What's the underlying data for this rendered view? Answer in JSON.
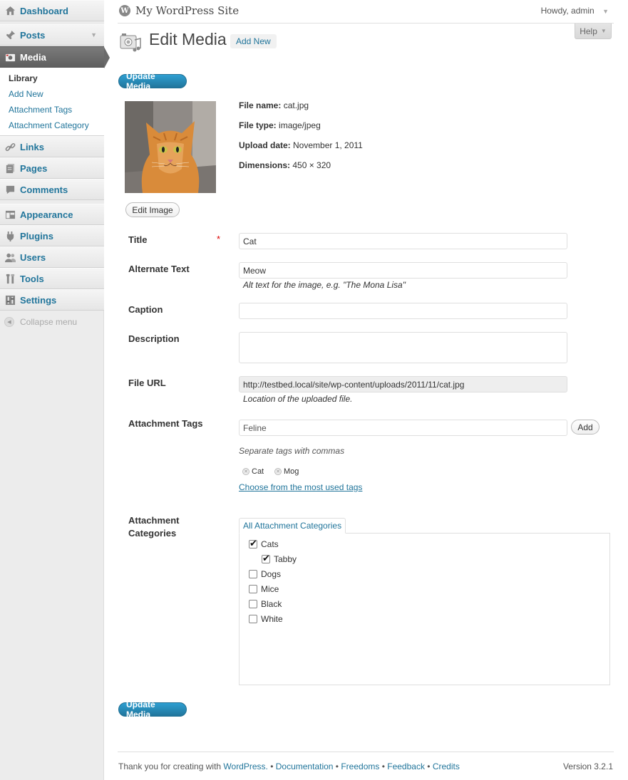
{
  "site": {
    "title": "My WordPress Site",
    "howdy": "Howdy, admin"
  },
  "help": {
    "label": "Help"
  },
  "sidebar": {
    "dashboard": "Dashboard",
    "posts": "Posts",
    "media": "Media",
    "media_submenu": [
      "Library",
      "Add New",
      "Attachment Tags",
      "Attachment Category"
    ],
    "links": "Links",
    "pages": "Pages",
    "comments": "Comments",
    "appearance": "Appearance",
    "plugins": "Plugins",
    "users": "Users",
    "tools": "Tools",
    "settings": "Settings",
    "collapse": "Collapse menu"
  },
  "page": {
    "title": "Edit Media",
    "add_new": "Add New",
    "update_button": "Update Media",
    "edit_image_button": "Edit Image"
  },
  "meta": {
    "file_name_label": "File name:",
    "file_name": "cat.jpg",
    "file_type_label": "File type:",
    "file_type": "image/jpeg",
    "upload_date_label": "Upload date:",
    "upload_date": "November 1, 2011",
    "dimensions_label": "Dimensions:",
    "dimensions": "450 × 320"
  },
  "fields": {
    "title_label": "Title",
    "required_mark": "*",
    "title_value": "Cat",
    "alt_label": "Alternate Text",
    "alt_value": "Meow",
    "alt_help": "Alt text for the image, e.g. \"The Mona Lisa\"",
    "caption_label": "Caption",
    "caption_value": "",
    "description_label": "Description",
    "description_value": "",
    "url_label": "File URL",
    "url_value": "http://testbed.local/site/wp-content/uploads/2011/11/cat.jpg",
    "url_help": "Location of the uploaded file."
  },
  "tags": {
    "label": "Attachment Tags",
    "input_value": "Feline",
    "add_button": "Add",
    "help": "Separate tags with commas",
    "items": [
      "Cat",
      "Mog"
    ],
    "most_used": "Choose from the most used tags"
  },
  "categories": {
    "label_line1": "Attachment",
    "label_line2": "Categories",
    "tab": "All Attachment Categories",
    "items": [
      {
        "name": "Cats",
        "checked": true
      },
      {
        "name": "Tabby",
        "checked": true
      },
      {
        "name": "Dogs",
        "checked": false
      },
      {
        "name": "Mice",
        "checked": false
      },
      {
        "name": "Black",
        "checked": false
      },
      {
        "name": "White",
        "checked": false
      }
    ]
  },
  "footer": {
    "thanks": "Thank you for creating with ",
    "wordpress": "WordPress.",
    "documentation": "Documentation",
    "freedoms": "Freedoms",
    "feedback": "Feedback",
    "credits": "Credits",
    "bullet": " • ",
    "version": "Version 3.2.1"
  },
  "colors": {
    "link": "#21759b",
    "primary_button": "#21759b",
    "required": "#dd0000"
  },
  "icons": [
    "wordpress-logo-icon",
    "dashboard-icon",
    "pin-icon",
    "media-icon",
    "link-icon",
    "pages-icon",
    "comment-icon",
    "appearance-icon",
    "plugin-icon",
    "users-icon",
    "tools-icon",
    "settings-icon",
    "collapse-icon"
  ]
}
